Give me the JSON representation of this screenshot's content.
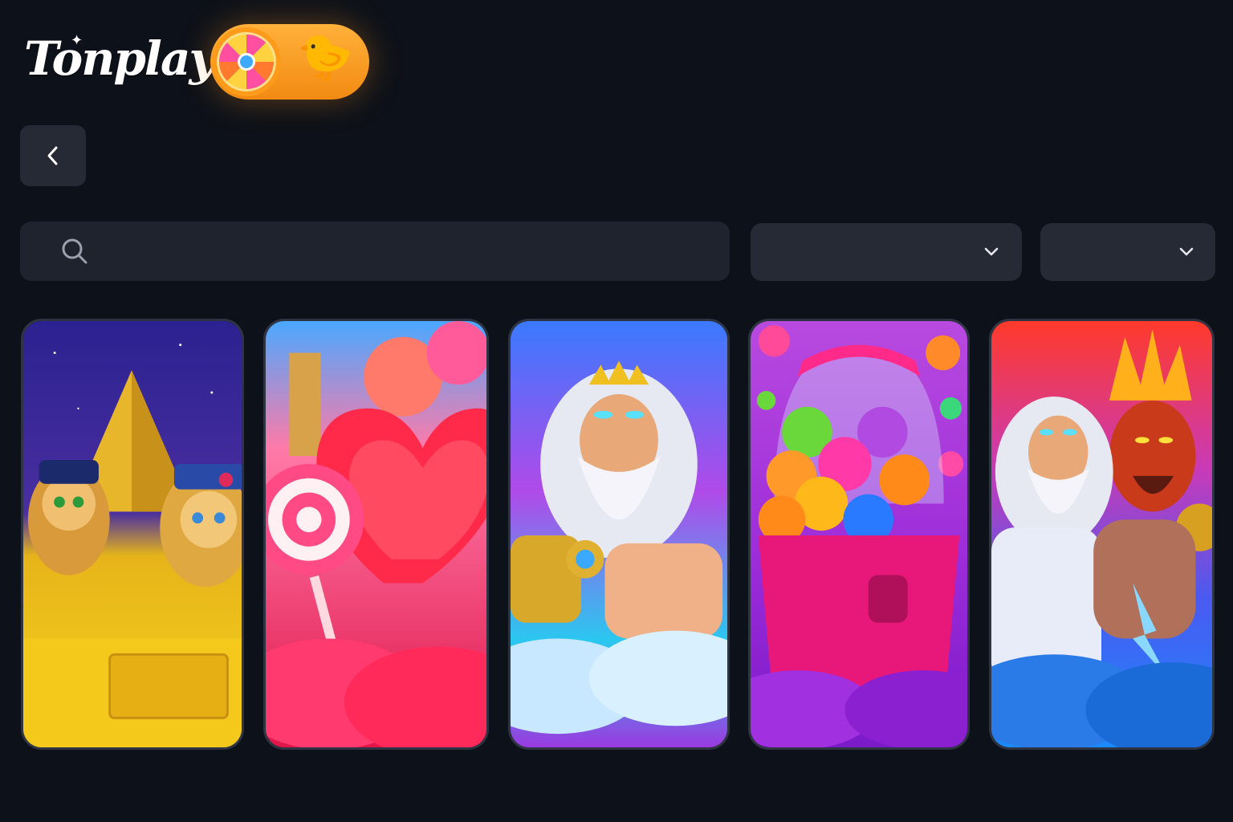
{
  "header": {
    "logo_text": "Tonplay",
    "promo": {
      "wheel_icon": "fortune-wheel-icon",
      "duck_icon": "rubber-duck-icon"
    }
  },
  "nav": {
    "back_icon": "chevron-left-icon"
  },
  "filters": {
    "search": {
      "icon": "search-icon",
      "placeholder": "",
      "value": ""
    },
    "dropdown_1": {
      "label": "",
      "icon": "chevron-down-icon"
    },
    "dropdown_2": {
      "label": "",
      "icon": "chevron-down-icon"
    }
  },
  "games": [
    {
      "theme": "egyptian-cats-pyramid",
      "colors": [
        "#2a1f7a",
        "#f2c21a"
      ]
    },
    {
      "theme": "candy-hearts-lollipop",
      "colors": [
        "#ff5a8a",
        "#e01d4a"
      ]
    },
    {
      "theme": "zeus-olympus",
      "colors": [
        "#3a8cff",
        "#a23fd8"
      ]
    },
    {
      "theme": "gumball-machine-candy",
      "colors": [
        "#b43fd8",
        "#ff3d9e"
      ]
    },
    {
      "theme": "zeus-vs-hades",
      "colors": [
        "#ff4a2a",
        "#2a7aff"
      ]
    }
  ]
}
